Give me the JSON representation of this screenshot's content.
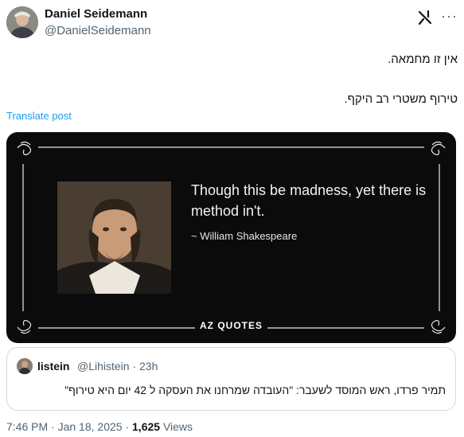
{
  "author": {
    "name": "Daniel Seidemann",
    "handle": "@DanielSeidemann"
  },
  "post": {
    "line1": "אין זו מחמאה.",
    "line2": "טירוף משטרי רב היקף.",
    "translate_label": "Translate post"
  },
  "image": {
    "quote": "Though this be madness, yet there is method in't.",
    "attribution": "~ William Shakespeare",
    "brand": "AZ QUOTES"
  },
  "quoted_post": {
    "name": "listein",
    "handle_time": "@Lihistein · 23h",
    "text": "תמיר פרדו, ראש המוסד לשעבר: \"העובדה שמרחנו את העסקה ל 42 יום היא טירוף\""
  },
  "meta": {
    "time": "7:46 PM",
    "date": "Jan 18, 2025",
    "views_count": "1,625",
    "views_label": "Views"
  },
  "icons": {
    "grok": "grok-icon",
    "more": "more-options-icon"
  },
  "colors": {
    "link": "#1d9bf0",
    "secondary_text": "#536471",
    "image_background": "#0b0b0b"
  }
}
